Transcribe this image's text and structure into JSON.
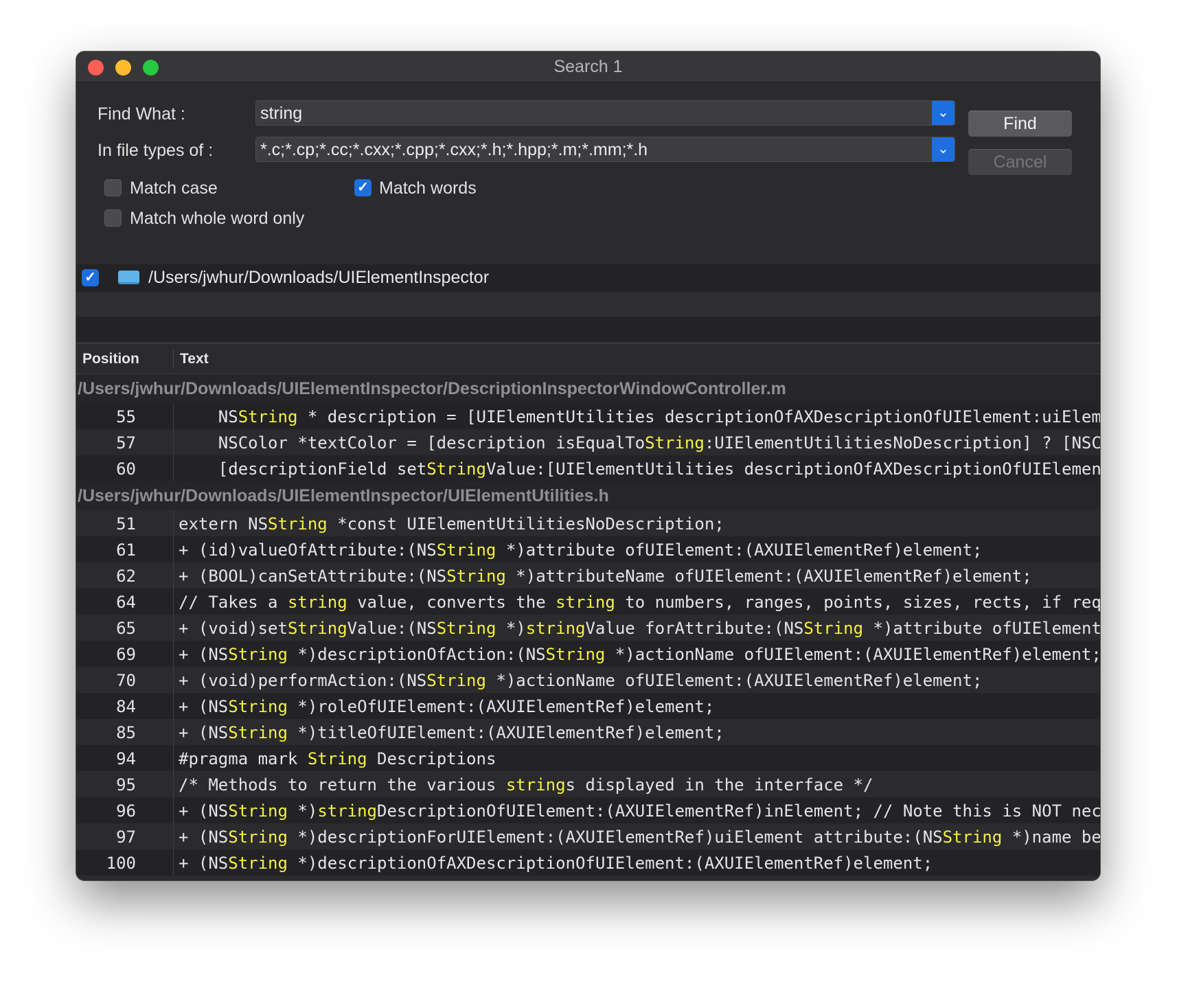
{
  "window": {
    "title": "Search 1"
  },
  "form": {
    "find_label": "Find What :",
    "find_value": "string",
    "types_label": "In file types of :",
    "types_value": "*.c;*.cp;*.cc;*.cxx;*.cpp;*.cxx;*.h;*.hpp;*.m;*.mm;*.h",
    "find_button": "Find",
    "cancel_button": "Cancel",
    "match_case": {
      "label": "Match case",
      "checked": false
    },
    "match_words": {
      "label": "Match words",
      "checked": true
    },
    "match_whole": {
      "label": "Match whole word only",
      "checked": false
    }
  },
  "directory": {
    "path": "/Users/jwhur/Downloads/UIElementInspector",
    "checked": true
  },
  "columns": {
    "position": "Position",
    "text": "Text"
  },
  "results": [
    {
      "file": "/Users/jwhur/Downloads/UIElementInspector/DescriptionInspectorWindowController.m",
      "lines": [
        {
          "n": "55",
          "segs": [
            [
              "    NS",
              0
            ],
            [
              "String",
              1
            ],
            [
              " * description = [UIElementUtilities descriptionOfAXDescriptionOfUIElement:uiElem",
              0
            ]
          ]
        },
        {
          "n": "57",
          "segs": [
            [
              "    NSColor *textColor = [description isEqualTo",
              0
            ],
            [
              "String",
              1
            ],
            [
              ":UIElementUtilitiesNoDescription] ? [NSC",
              0
            ]
          ]
        },
        {
          "n": "60",
          "segs": [
            [
              "    [descriptionField set",
              0
            ],
            [
              "String",
              1
            ],
            [
              "Value:[UIElementUtilities descriptionOfAXDescriptionOfUIElement",
              0
            ]
          ]
        }
      ]
    },
    {
      "file": "/Users/jwhur/Downloads/UIElementInspector/UIElementUtilities.h",
      "lines": [
        {
          "n": "51",
          "segs": [
            [
              "extern NS",
              0
            ],
            [
              "String",
              1
            ],
            [
              " *const UIElementUtilitiesNoDescription;",
              0
            ]
          ]
        },
        {
          "n": "61",
          "segs": [
            [
              "+ (id)valueOfAttribute:(NS",
              0
            ],
            [
              "String",
              1
            ],
            [
              " *)attribute ofUIElement:(AXUIElementRef)element;",
              0
            ]
          ]
        },
        {
          "n": "62",
          "segs": [
            [
              "+ (BOOL)canSetAttribute:(NS",
              0
            ],
            [
              "String",
              1
            ],
            [
              " *)attributeName ofUIElement:(AXUIElementRef)element;",
              0
            ]
          ]
        },
        {
          "n": "64",
          "segs": [
            [
              "// Takes a ",
              0
            ],
            [
              "string",
              1
            ],
            [
              " value, converts the ",
              0
            ],
            [
              "string",
              1
            ],
            [
              " to numbers, ranges, points, sizes, rects, if req",
              0
            ]
          ]
        },
        {
          "n": "65",
          "segs": [
            [
              "+ (void)set",
              0
            ],
            [
              "String",
              1
            ],
            [
              "Value:(NS",
              0
            ],
            [
              "String",
              1
            ],
            [
              " *)",
              0
            ],
            [
              "string",
              1
            ],
            [
              "Value forAttribute:(NS",
              0
            ],
            [
              "String",
              1
            ],
            [
              " *)attribute ofUIElement",
              0
            ]
          ]
        },
        {
          "n": "69",
          "segs": [
            [
              "+ (NS",
              0
            ],
            [
              "String",
              1
            ],
            [
              " *)descriptionOfAction:(NS",
              0
            ],
            [
              "String",
              1
            ],
            [
              " *)actionName ofUIElement:(AXUIElementRef)element;",
              0
            ]
          ]
        },
        {
          "n": "70",
          "segs": [
            [
              "+ (void)performAction:(NS",
              0
            ],
            [
              "String",
              1
            ],
            [
              " *)actionName ofUIElement:(AXUIElementRef)element;",
              0
            ]
          ]
        },
        {
          "n": "84",
          "segs": [
            [
              "+ (NS",
              0
            ],
            [
              "String",
              1
            ],
            [
              " *)roleOfUIElement:(AXUIElementRef)element;",
              0
            ]
          ]
        },
        {
          "n": "85",
          "segs": [
            [
              "+ (NS",
              0
            ],
            [
              "String",
              1
            ],
            [
              " *)titleOfUIElement:(AXUIElementRef)element;",
              0
            ]
          ]
        },
        {
          "n": "94",
          "segs": [
            [
              "#pragma mark ",
              0
            ],
            [
              "String",
              1
            ],
            [
              " Descriptions",
              0
            ]
          ]
        },
        {
          "n": "95",
          "segs": [
            [
              "/* Methods to return the various ",
              0
            ],
            [
              "string",
              1
            ],
            [
              "s displayed in the interface */",
              0
            ]
          ]
        },
        {
          "n": "96",
          "segs": [
            [
              "+ (NS",
              0
            ],
            [
              "String",
              1
            ],
            [
              " *)",
              0
            ],
            [
              "string",
              1
            ],
            [
              "DescriptionOfUIElement:(AXUIElementRef)inElement; // Note this is NOT nec",
              0
            ]
          ]
        },
        {
          "n": "97",
          "segs": [
            [
              "+ (NS",
              0
            ],
            [
              "String",
              1
            ],
            [
              " *)descriptionForUIElement:(AXUIElementRef)uiElement attribute:(NS",
              0
            ],
            [
              "String",
              1
            ],
            [
              " *)name be",
              0
            ]
          ]
        },
        {
          "n": "100",
          "segs": [
            [
              "+ (NS",
              0
            ],
            [
              "String",
              1
            ],
            [
              " *)descriptionOfAXDescriptionOfUIElement:(AXUIElementRef)element;",
              0
            ]
          ]
        }
      ]
    }
  ],
  "colors": {
    "accent": "#1f6ee0",
    "highlight": "#f4f146",
    "background": "#2b2b2d"
  }
}
